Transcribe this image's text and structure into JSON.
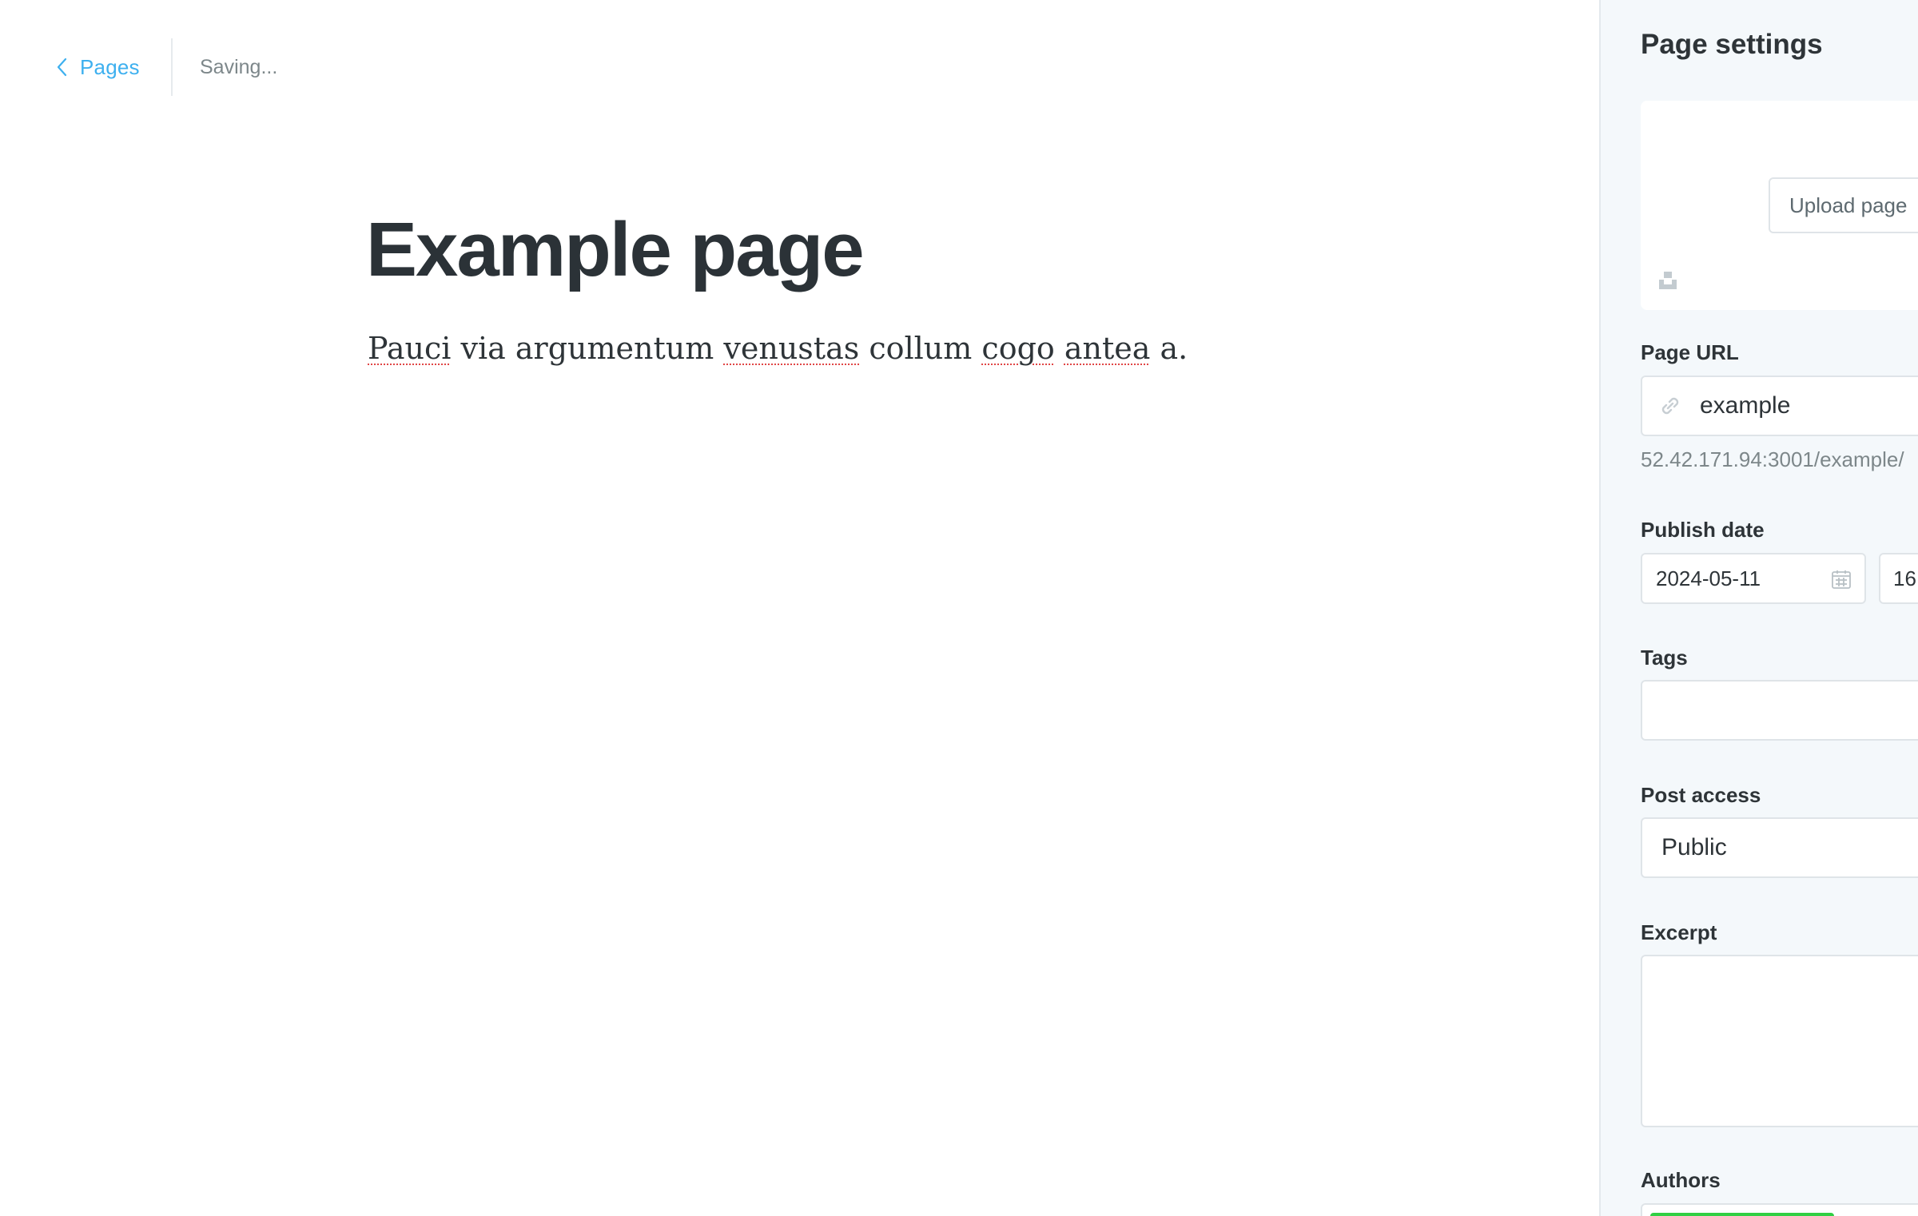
{
  "header": {
    "back_label": "Pages",
    "status": "Saving..."
  },
  "editor": {
    "title": "Example page",
    "body_words": [
      "Pauci",
      "via",
      "argumentum",
      "venustas",
      "collum",
      "cogo",
      "antea",
      "a."
    ]
  },
  "settings": {
    "title": "Page settings",
    "image": {
      "upload_label": "Upload page"
    },
    "url": {
      "label": "Page URL",
      "value": "example",
      "hint": "52.42.171.94:3001/example/"
    },
    "publish": {
      "label": "Publish date",
      "date": "2024-05-11",
      "time": "16:"
    },
    "tags": {
      "label": "Tags",
      "value": ""
    },
    "access": {
      "label": "Post access",
      "value": "Public"
    },
    "excerpt": {
      "label": "Excerpt",
      "value": ""
    },
    "authors": {
      "label": "Authors"
    }
  },
  "colors": {
    "accent": "#3eb0ef",
    "spellcheck": "#e04646",
    "author_chip": "#30cf43",
    "panel_bg": "#f4f8fb"
  }
}
